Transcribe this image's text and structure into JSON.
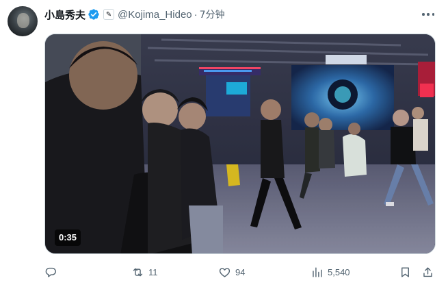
{
  "tweet": {
    "author_name": "小島秀夫",
    "handle": "@Kojima_Hideo",
    "separator": "·",
    "time": "7分钟",
    "affiliate_badge_glyph": "✎",
    "video_duration": "0:35",
    "verified_color": "#1d9bf0"
  },
  "actions": {
    "reply_icon": "reply-icon",
    "retweet_icon": "retweet-icon",
    "retweet_count": "11",
    "like_icon": "like-icon",
    "like_count": "94",
    "views_icon": "views-icon",
    "views_count": "5,540",
    "bookmark_icon": "bookmark-icon",
    "share_icon": "share-icon"
  }
}
